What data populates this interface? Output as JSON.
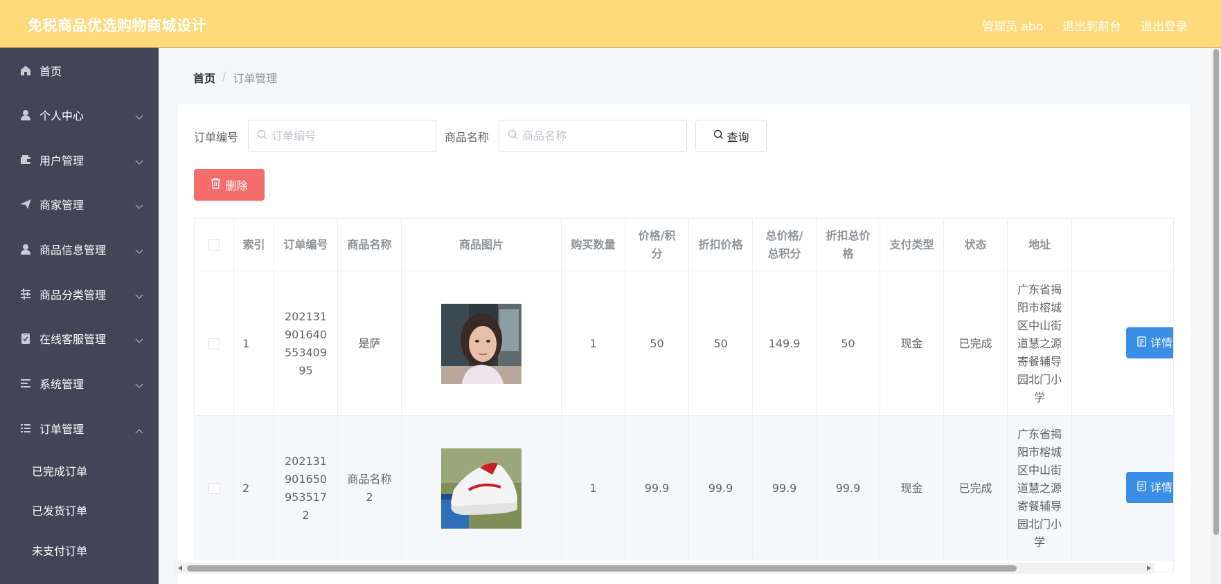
{
  "header": {
    "title": "免税商品优选购物商城设计",
    "admin": "管理员 abo",
    "to_front": "退出到前台",
    "logout": "退出登录"
  },
  "sidebar": {
    "items": [
      {
        "label": "首页",
        "icon": "home-icon"
      },
      {
        "label": "个人中心",
        "icon": "user-icon"
      },
      {
        "label": "用户管理",
        "icon": "wallet-icon"
      },
      {
        "label": "商家管理",
        "icon": "send-icon"
      },
      {
        "label": "商品信息管理",
        "icon": "user-icon"
      },
      {
        "label": "商品分类管理",
        "icon": "sliders-icon"
      },
      {
        "label": "在线客服管理",
        "icon": "clipboard-icon"
      },
      {
        "label": "系统管理",
        "icon": "list-icon"
      },
      {
        "label": "订单管理",
        "icon": "list-icon"
      }
    ],
    "subitems": [
      "已完成订单",
      "已发货订单",
      "未支付订单"
    ]
  },
  "breadcrumb": {
    "home": "首页",
    "separator": "/",
    "current": "订单管理"
  },
  "search": {
    "order_label": "订单编号",
    "order_placeholder": "订单编号",
    "product_label": "商品名称",
    "product_placeholder": "商品名称",
    "query_button": "查询"
  },
  "actions": {
    "delete_button": "删除",
    "detail_button": "详情"
  },
  "table": {
    "headers": {
      "index": "索引",
      "order_no": "订单编号",
      "product_name": "商品名称",
      "image": "商品图片",
      "quantity": "购买数量",
      "price": "价格/积分",
      "discount_price": "折扣价格",
      "total": "总价格/总积分",
      "discount_total": "折扣总价格",
      "pay_type": "支付类型",
      "status": "状态",
      "address": "地址"
    },
    "rows": [
      {
        "index": "1",
        "order_no": "20213190164055340995",
        "product_name": "是萨",
        "image": "portrait-photo",
        "quantity": "1",
        "price": "50",
        "discount_price": "50",
        "total": "149.9",
        "discount_total": "50",
        "pay_type": "现金",
        "status": "已完成",
        "address": "广东省揭阳市榕城区中山街道慧之源寄餐辅导园北门小学"
      },
      {
        "index": "2",
        "order_no": "2021319016509535172",
        "product_name": "商品名称2",
        "image": "sneaker-photo",
        "quantity": "1",
        "price": "99.9",
        "discount_price": "99.9",
        "total": "99.9",
        "discount_total": "99.9",
        "pay_type": "现金",
        "status": "已完成",
        "address": "广东省揭阳市榕城区中山街道慧之源寄餐辅导园北门小学"
      }
    ]
  },
  "colors": {
    "header_bg": "#ffd97a",
    "sidebar_bg": "#404655",
    "delete_bg": "#f56c6c",
    "detail_bg": "#3a8ee6"
  }
}
